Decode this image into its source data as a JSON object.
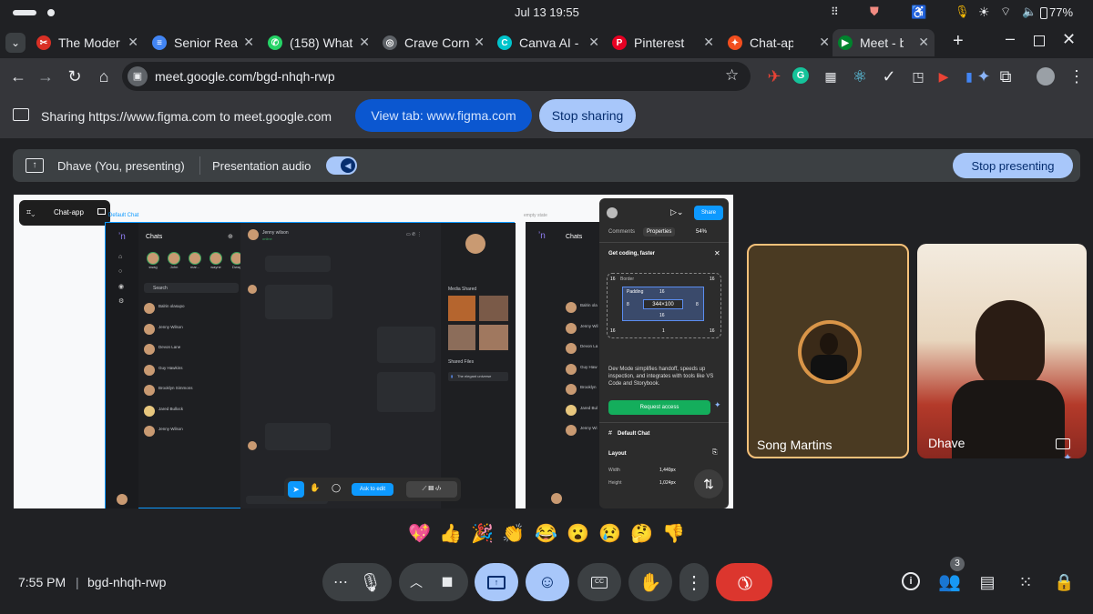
{
  "status_bar": {
    "time_date": "Jul 13  19:55",
    "battery": "77%"
  },
  "tabs": [
    {
      "title": "The Moder",
      "fav_color": "#d93025",
      "fav_glyph": "✂"
    },
    {
      "title": "Senior Rea",
      "fav_color": "#4285f4",
      "fav_glyph": "≡"
    },
    {
      "title": "(158) What",
      "fav_color": "#25d366",
      "fav_glyph": "✆"
    },
    {
      "title": "Crave Corn",
      "fav_color": "#5f6368",
      "fav_glyph": "◎"
    },
    {
      "title": "Canva AI - ",
      "fav_color": "#00c4cc",
      "fav_glyph": "C"
    },
    {
      "title": "Pinterest",
      "fav_color": "#e60023",
      "fav_glyph": "P"
    },
    {
      "title": "Chat-ap",
      "fav_color": "#f24e1e",
      "fav_glyph": "✦"
    },
    {
      "title": "Meet - b",
      "fav_color": "#00832d",
      "fav_glyph": "▶"
    }
  ],
  "omnibox": {
    "url": "meet.google.com/bgd-nhqh-rwp"
  },
  "sharebar": {
    "text": "Sharing https://www.figma.com to meet.google.com",
    "view_tab": "View tab: www.figma.com",
    "stop_sharing": "Stop sharing"
  },
  "present_bar": {
    "presenter": "Dhave (You, presenting)",
    "audio": "Presentation audio",
    "stop_presenting": "Stop presenting"
  },
  "figma": {
    "file_name": "Chat-app",
    "frame_label": "Default Chat",
    "frame_label2": "empty state",
    "chats_title": "Chats",
    "search": "Search",
    "stories": [
      "swag",
      "John",
      "mar...",
      "wayne",
      "Dway"
    ],
    "chat_list": [
      "Balrin olasupo",
      "Jenny Wilson",
      "Devon Lane",
      "Guy Hawkins",
      "Brooklyn Simmons",
      "Jared Bullock",
      "Jenny Wilson"
    ],
    "right_chats": [
      "Balrin ola",
      "Jenny Wil",
      "Devon La",
      "Guy Haw",
      "Brooklyn",
      "Jared Bul",
      "Jenny Wi"
    ],
    "contact": "Jenny wilson",
    "contact_status": "online",
    "media_shared": "Media Shared",
    "shared_files": "Shared Files",
    "shared_file": "The elegant universe",
    "ask_to_edit": "Ask to edit",
    "panel": {
      "share": "Share",
      "comments": "Comments",
      "properties": "Properties",
      "zoom": "54%",
      "promo": "Get coding, faster",
      "border": "Border",
      "padding": "Padding",
      "size": "344×100",
      "num16": "16",
      "num8": "8",
      "num1": "1",
      "desc": "Dev Mode simplifies handoff, speeds up inspection, and integrates with tools like VS Code and Storybook.",
      "request": "Request access",
      "frame": "Default Chat",
      "layout": "Layout",
      "width_label": "Width",
      "width_val": "1,440px",
      "height_label": "Height",
      "height_val": "1,024px"
    }
  },
  "participants": [
    {
      "name": "Song Martins"
    },
    {
      "name": "Dhave"
    }
  ],
  "reactions": [
    "💖",
    "👍",
    "🎉",
    "👏",
    "😂",
    "😮",
    "😢",
    "🤔",
    "👎"
  ],
  "bottom": {
    "meeting_time": "7:55 PM",
    "separator": "|",
    "meeting_code": "bgd-nhqh-rwp",
    "people_count": "3"
  },
  "colors": {
    "accent": "#a8c7fa",
    "end_call": "#dc362e",
    "view_tab_bg": "#0b57d0",
    "request_green": "#14ae5c",
    "figma_blue": "#0d99ff"
  }
}
